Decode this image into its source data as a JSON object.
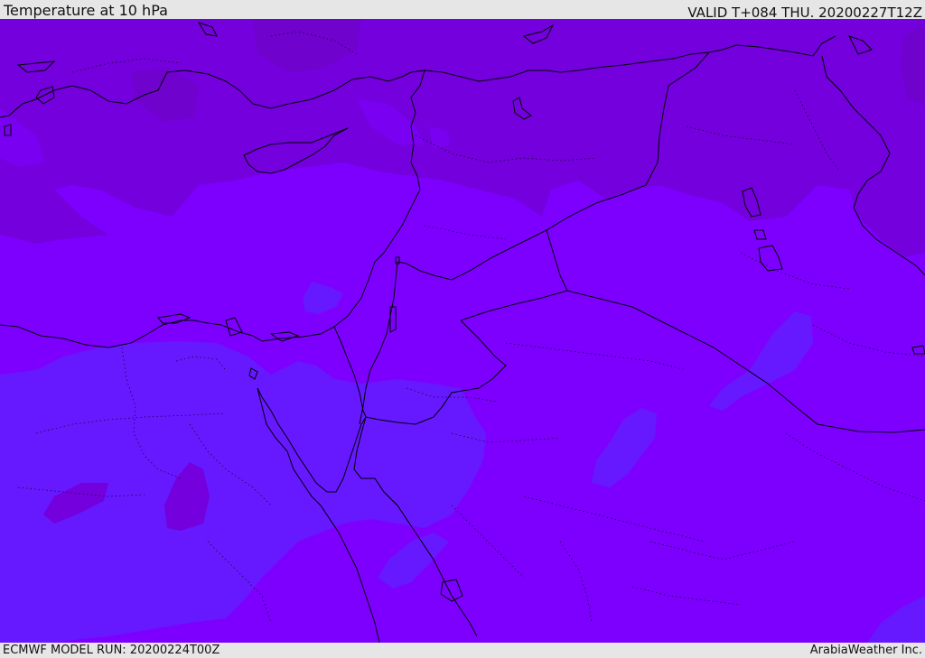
{
  "header": {
    "title": "Temperature at 10 hPa",
    "valid": "VALID T+084 THU. 20200227T12Z"
  },
  "footer": {
    "model_run": "ECMWF MODEL RUN: 20200224T00Z",
    "credit": "ArabiaWeather Inc."
  },
  "colors": {
    "base_fill": "#7d00ff",
    "warm_fill": "#7300dd",
    "warmer_fill": "#6f02cc",
    "cool_fill": "#6618ff",
    "coastline": "#000000"
  }
}
